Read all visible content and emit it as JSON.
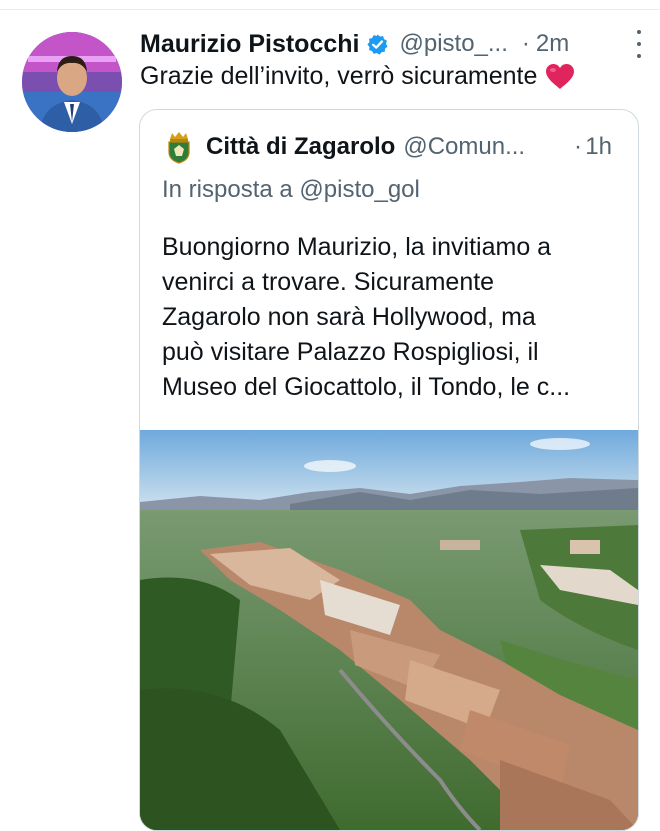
{
  "tweet": {
    "author_name": "Maurizio Pistocchi",
    "author_handle": "@pisto_...",
    "dot": "·",
    "time": "2m",
    "text": "Grazie dell’invito, verrò sicuramente",
    "verified": true
  },
  "quoted": {
    "author_name": "Città di Zagarolo",
    "author_handle": "@Comun...",
    "dot": "·",
    "time": "1h",
    "reply_prefix": "In risposta a",
    "reply_to": "@pisto_gol",
    "text_lines": [
      "Buongiorno Maurizio, la invitiamo a",
      "venirci a trovare. Sicuramente",
      "Zagarolo non sarà Hollywood, ma",
      "può visitare Palazzo Rospigliosi, il",
      "Museo del Giocattolo, il Tondo, le c..."
    ]
  },
  "colors": {
    "text": "#0f1419",
    "secondary": "#536471",
    "verified": "#1d9bf0",
    "heart": "#e0245e",
    "border": "#cfd9de"
  },
  "icons": {
    "verified": "verified-badge-icon",
    "more": "more-options-icon",
    "heart": "red-heart-emoji",
    "crest": "municipal-crest-icon"
  }
}
